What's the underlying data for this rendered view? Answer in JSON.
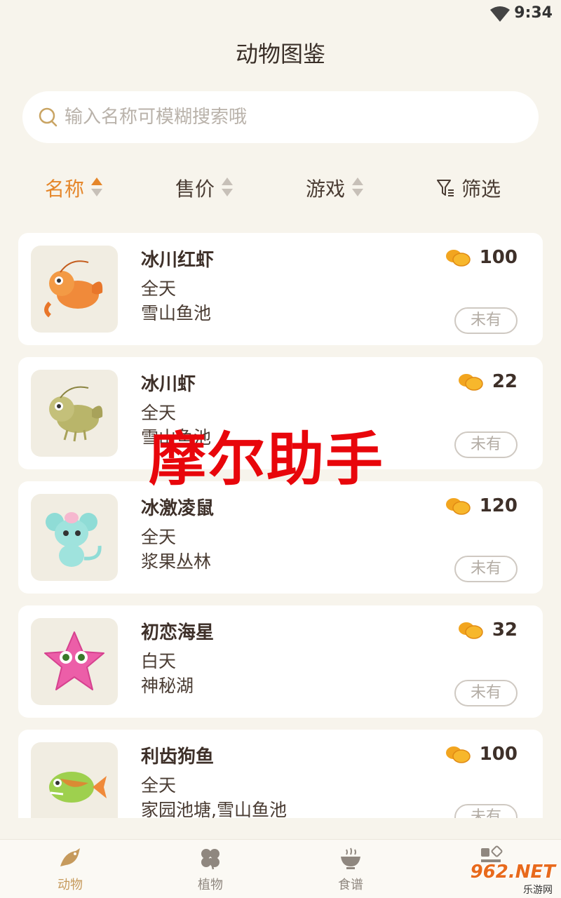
{
  "status": {
    "time": "9:34"
  },
  "page": {
    "title": "动物图鉴"
  },
  "search": {
    "placeholder": "输入名称可模糊搜索哦"
  },
  "sort": {
    "name": "名称",
    "price": "售价",
    "game": "游戏",
    "filter": "筛选"
  },
  "colors": {
    "accent": "#e5862a",
    "background": "#f7f4ec",
    "watermark": "#e8060b"
  },
  "animals": [
    {
      "name": "冰川红虾",
      "time": "全天",
      "place": "雪山鱼池",
      "price": "100",
      "status": "未有",
      "icon": "red-shrimp-icon"
    },
    {
      "name": "冰川虾",
      "time": "全天",
      "place": "雪山鱼池",
      "price": "22",
      "status": "未有",
      "icon": "green-shrimp-icon"
    },
    {
      "name": "冰激凌鼠",
      "time": "全天",
      "place": "浆果丛林",
      "price": "120",
      "status": "未有",
      "icon": "ice-cream-mouse-icon"
    },
    {
      "name": "初恋海星",
      "time": "白天",
      "place": "神秘湖",
      "price": "32",
      "status": "未有",
      "icon": "pink-starfish-icon"
    },
    {
      "name": "利齿狗鱼",
      "time": "全天",
      "place": "家园池塘,雪山鱼池",
      "price": "100",
      "status": "未有",
      "icon": "pike-fish-icon"
    }
  ],
  "watermark": "摩尔助手",
  "nav": {
    "animals": "动物",
    "plants": "植物",
    "recipes": "食谱",
    "other": ""
  },
  "site_logo": {
    "big": "962.NET",
    "small": "乐游网"
  }
}
